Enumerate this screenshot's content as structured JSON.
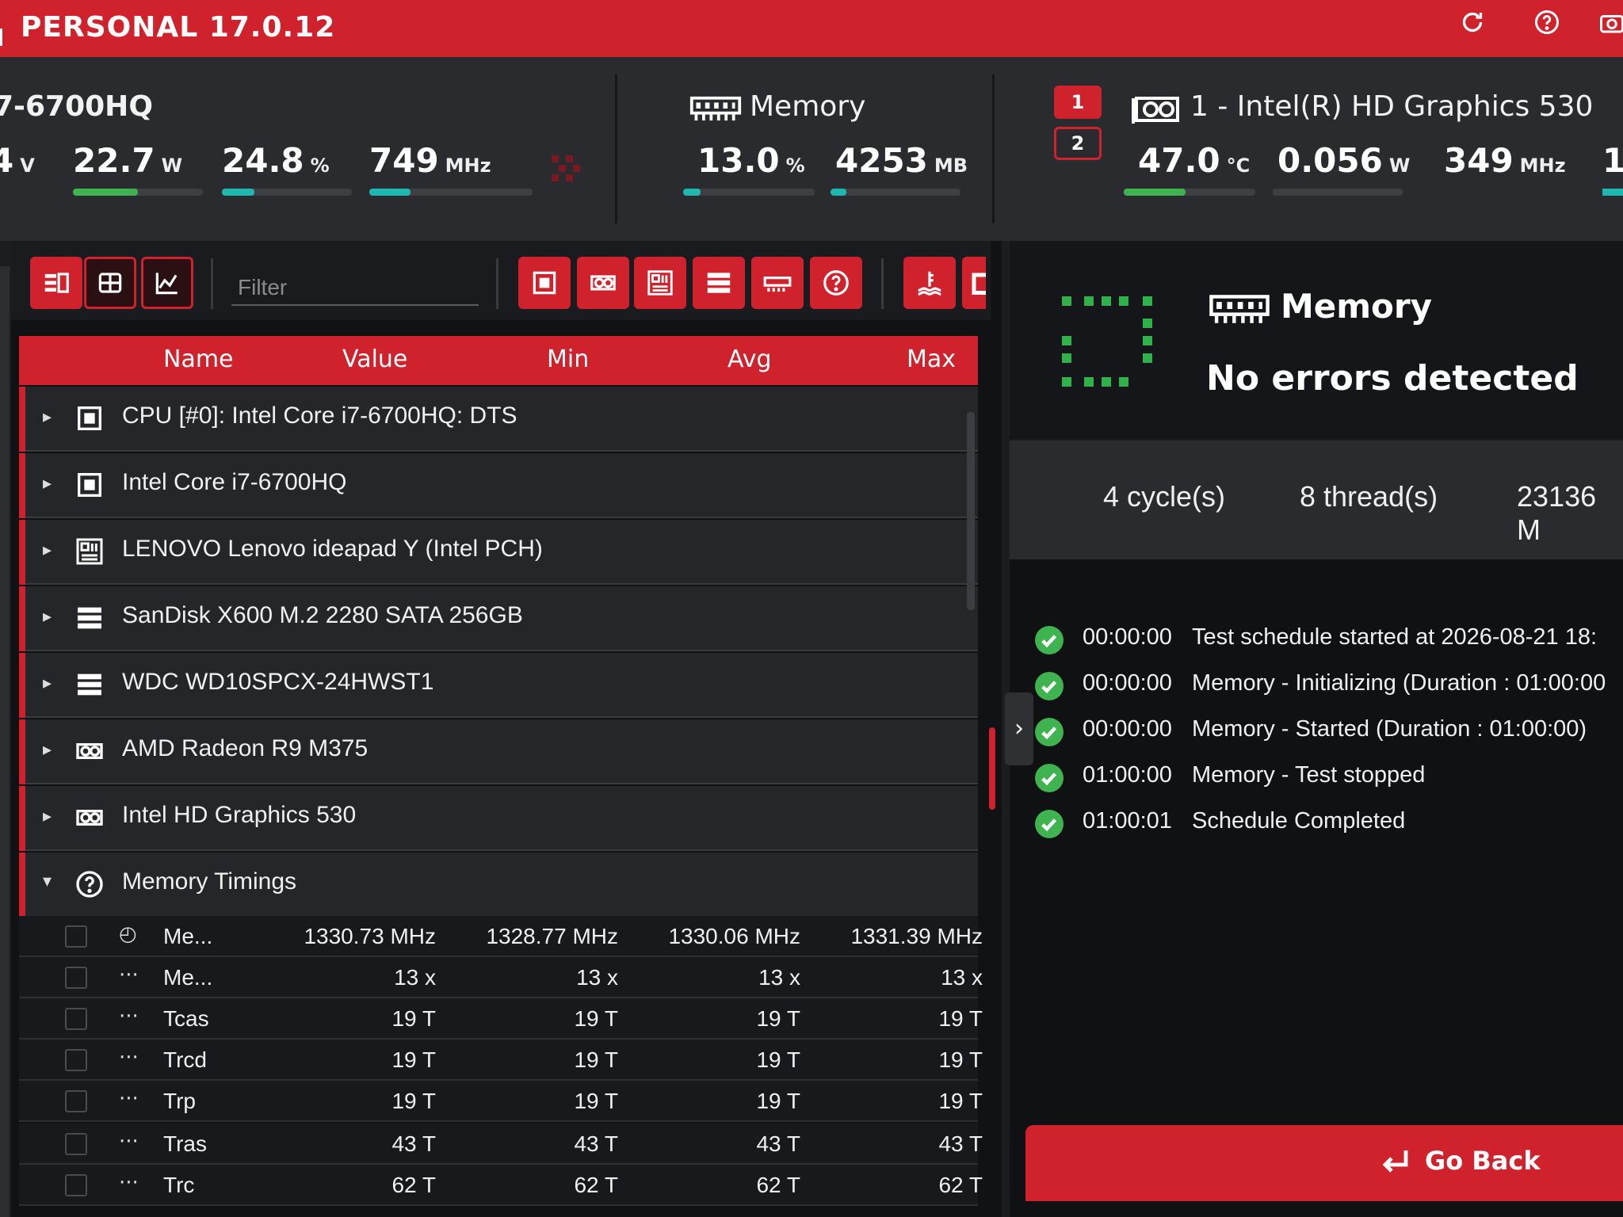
{
  "app": {
    "title": "PERSONAL 17.0.12"
  },
  "titlebar_icons": [
    "refresh-icon",
    "help-icon",
    "camera-icon"
  ],
  "cpu": {
    "title": "7-6700HQ",
    "voltage_fragment": "4",
    "voltage_unit": "V",
    "power": {
      "value": "22.7",
      "unit": "W",
      "level": 0.5
    },
    "load": {
      "value": "24.8",
      "unit": "%",
      "level": 0.248
    },
    "clock": {
      "value": "749",
      "unit": "MHz",
      "level": 0.25
    }
  },
  "memory": {
    "title": "Memory",
    "usage": {
      "value": "13.0",
      "unit": "%",
      "level": 0.13
    },
    "used": {
      "value": "4253",
      "unit": "MB",
      "level": 0.12
    }
  },
  "gpu": {
    "tabs": [
      "1",
      "2"
    ],
    "title": "1 - Intel(R) HD Graphics 530",
    "temp": {
      "value": "47.0",
      "unit": "°C",
      "level": 0.47
    },
    "power": {
      "value": "0.056",
      "unit": "W",
      "level": 0.0
    },
    "clock": {
      "value": "349",
      "unit": "MHz",
      "level": 0.0
    }
  },
  "toolbar": {
    "filter_placeholder": "Filter",
    "view_buttons": [
      "list-view-icon",
      "grid-view-icon",
      "chart-view-icon"
    ],
    "category_buttons": [
      "cpu-icon",
      "gpu-icon",
      "motherboard-icon",
      "storage-icon",
      "memory-icon",
      "help-icon",
      "temperature-icon",
      "battery-icon"
    ]
  },
  "table": {
    "headers": {
      "name": "Name",
      "value": "Value",
      "min": "Min",
      "avg": "Avg",
      "max": "Max"
    },
    "groups": [
      {
        "label": "CPU [#0]: Intel Core i7-6700HQ: DTS",
        "icon": "cpu-icon",
        "expanded": false
      },
      {
        "label": "Intel Core i7-6700HQ",
        "icon": "cpu-icon",
        "expanded": false
      },
      {
        "label": "LENOVO Lenovo ideapad Y (Intel PCH)",
        "icon": "motherboard-icon",
        "expanded": false
      },
      {
        "label": "SanDisk X600 M.2 2280 SATA 256GB",
        "icon": "storage-icon",
        "expanded": false
      },
      {
        "label": "WDC WD10SPCX-24HWST1",
        "icon": "storage-icon",
        "expanded": false
      },
      {
        "label": "AMD Radeon R9 M375",
        "icon": "gpu-icon",
        "expanded": false
      },
      {
        "label": "Intel HD Graphics 530",
        "icon": "gpu-icon",
        "expanded": false
      },
      {
        "label": "Memory Timings",
        "icon": "help-icon",
        "expanded": true
      }
    ],
    "rows": [
      {
        "icon": "gauge-icon",
        "name": "Me...",
        "value": "1330.73 MHz",
        "min": "1328.77 MHz",
        "avg": "1330.06 MHz",
        "max": "1331.39 MHz"
      },
      {
        "icon": "dots-icon",
        "name": "Me...",
        "value": "13 x",
        "min": "13 x",
        "avg": "13 x",
        "max": "13 x"
      },
      {
        "icon": "dots-icon",
        "name": "Tcas",
        "value": "19 T",
        "min": "19 T",
        "avg": "19 T",
        "max": "19 T"
      },
      {
        "icon": "dots-icon",
        "name": "Trcd",
        "value": "19 T",
        "min": "19 T",
        "avg": "19 T",
        "max": "19 T"
      },
      {
        "icon": "dots-icon",
        "name": "Trp",
        "value": "19 T",
        "min": "19 T",
        "avg": "19 T",
        "max": "19 T"
      },
      {
        "icon": "dots-icon",
        "name": "Tras",
        "value": "43 T",
        "min": "43 T",
        "avg": "43 T",
        "max": "43 T"
      },
      {
        "icon": "dots-icon",
        "name": "Trc",
        "value": "62 T",
        "min": "62 T",
        "avg": "62 T",
        "max": "62 T"
      }
    ]
  },
  "test": {
    "component": "Memory",
    "status": "No errors detected",
    "cycles": "4 cycle(s)",
    "threads": "8 thread(s)",
    "amount": "23136 M",
    "log": [
      {
        "time": "00:00:00",
        "message": "Test schedule started at 2026-08-21 18:"
      },
      {
        "time": "00:00:00",
        "message": "Memory - Initializing (Duration : 01:00:00"
      },
      {
        "time": "00:00:00",
        "message": "Memory - Started (Duration : 01:00:00)"
      },
      {
        "time": "01:00:00",
        "message": "Memory - Test stopped"
      },
      {
        "time": "01:00:01",
        "message": "Schedule Completed"
      }
    ],
    "go_back_label": "Go Back"
  },
  "colors": {
    "accent": "#d0222d",
    "green": "#3fb34f",
    "teal": "#1fb8b0"
  }
}
